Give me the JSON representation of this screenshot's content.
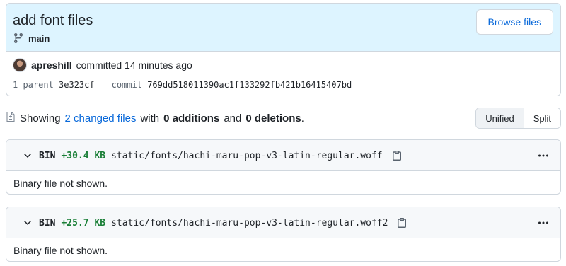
{
  "commit": {
    "title": "add font files",
    "branch": "main",
    "browse_label": "Browse files",
    "author": "apreshill",
    "action": "committed 14 minutes ago",
    "parent_label": "1 parent",
    "parent_sha": "3e323cf",
    "commit_label": "commit",
    "commit_sha": "769dd518011390ac1f133292fb421b16415407bd"
  },
  "summary": {
    "showing": "Showing",
    "changed_files": "2 changed files",
    "with": "with",
    "additions": "0 additions",
    "and": "and",
    "deletions": "0 deletions",
    "period": "."
  },
  "view_toggle": {
    "unified": "Unified",
    "split": "Split",
    "selected": "Unified"
  },
  "files": [
    {
      "type": "BIN",
      "size": "+30.4 KB",
      "path": "static/fonts/hachi-maru-pop-v3-latin-regular.woff",
      "body": "Binary file not shown."
    },
    {
      "type": "BIN",
      "size": "+25.7 KB",
      "path": "static/fonts/hachi-maru-pop-v3-latin-regular.woff2",
      "body": "Binary file not shown."
    }
  ],
  "colors": {
    "header_bg": "#ddf4ff",
    "link": "#0969da",
    "addition": "#1a7f37",
    "border": "#d0d7de"
  },
  "icons": {
    "branch": "git-branch-icon",
    "file_diff": "file-diff-icon",
    "chevron": "chevron-down-icon",
    "copy": "copy-icon",
    "more": "kebab-horizontal-icon"
  }
}
